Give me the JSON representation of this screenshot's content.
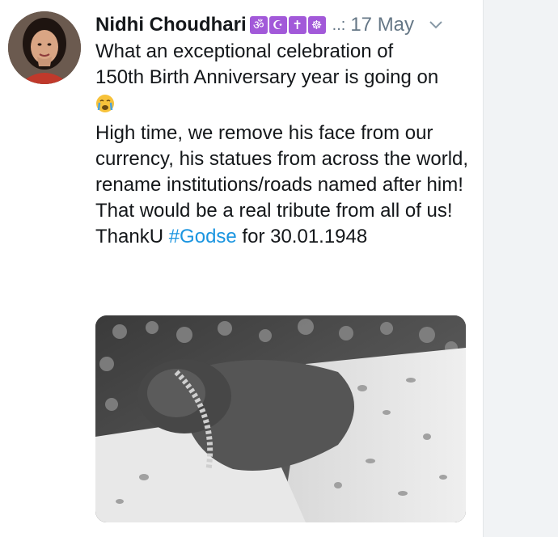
{
  "tweet": {
    "author_name": "Nidhi Choudhari",
    "badges": [
      "ॐ",
      "☪",
      "✝",
      "☸"
    ],
    "separator": "..:",
    "timestamp": "17 May",
    "caret_icon": "chevron-down-icon",
    "lines": [
      "What an exceptional celebration of",
      "150th Birth Anniversary year is going on"
    ],
    "emoji": "crying-face-icon",
    "paragraph_2": "High time, we remove his face from our currency, his statues from across the world, rename institutions/roads named after him!",
    "paragraph_3": "That would be a real tribute from all of us!",
    "thanks_prefix": "ThankU ",
    "hashtag": "#Godse",
    "thanks_suffix": " for 30.01.1948",
    "accent_color": "#1b95e0",
    "badge_color": "#a259d9"
  }
}
